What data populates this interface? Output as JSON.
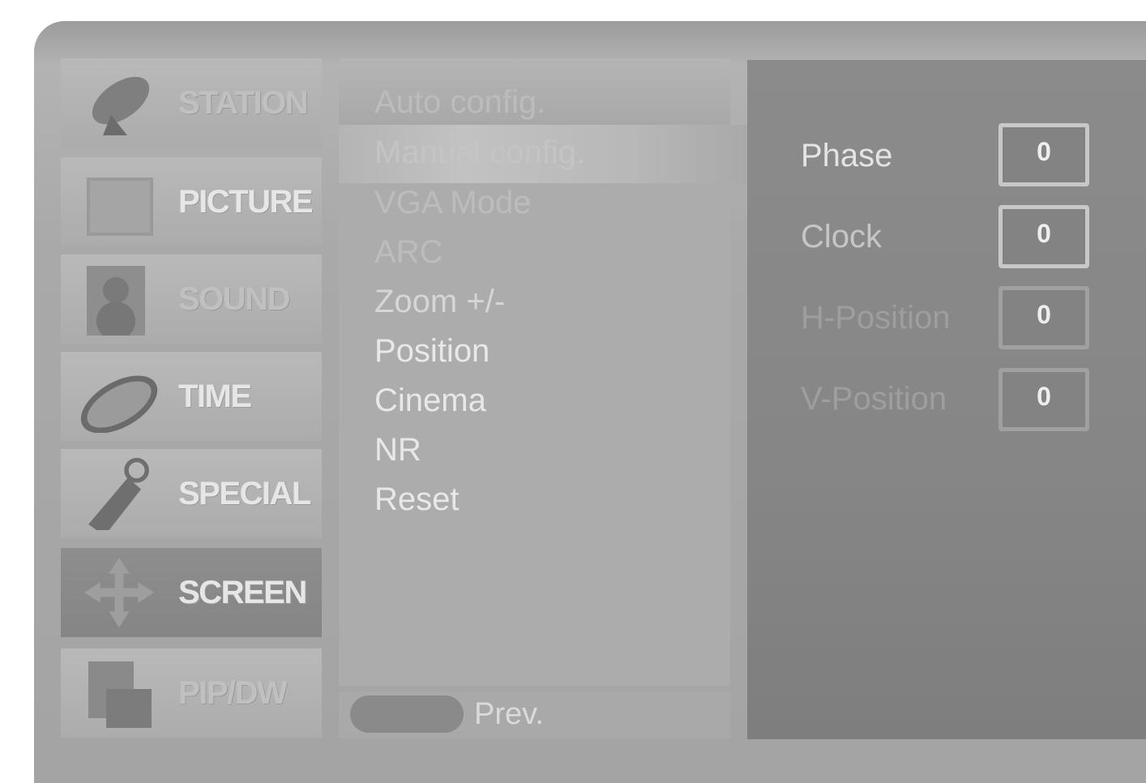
{
  "menu": {
    "categories": [
      {
        "label": "STATION",
        "icon": "satellite-dish-icon"
      },
      {
        "label": "PICTURE",
        "icon": "picture-frame-icon"
      },
      {
        "label": "SOUND",
        "icon": "speaker-icon"
      },
      {
        "label": "TIME",
        "icon": "clock-disc-icon"
      },
      {
        "label": "SPECIAL",
        "icon": "tag-icon"
      },
      {
        "label": "SCREEN",
        "icon": "move-arrows-icon",
        "active": true
      },
      {
        "label": "PIP/DW",
        "icon": "pip-windows-icon"
      }
    ],
    "screen_items": [
      "Auto config.",
      "Manual config.",
      "VGA Mode",
      "ARC",
      "Zoom +/-",
      "Position",
      "Cinema",
      "NR",
      "Reset"
    ],
    "footer": {
      "prev_label": "Prev."
    }
  },
  "manual_config": {
    "fields": [
      {
        "label": "Phase",
        "value": "0"
      },
      {
        "label": "Clock",
        "value": "0"
      },
      {
        "label": "H-Position",
        "value": "0"
      },
      {
        "label": "V-Position",
        "value": "0"
      }
    ]
  },
  "colors": {
    "active_category": "#888888",
    "panel": "#8a8a8a"
  }
}
